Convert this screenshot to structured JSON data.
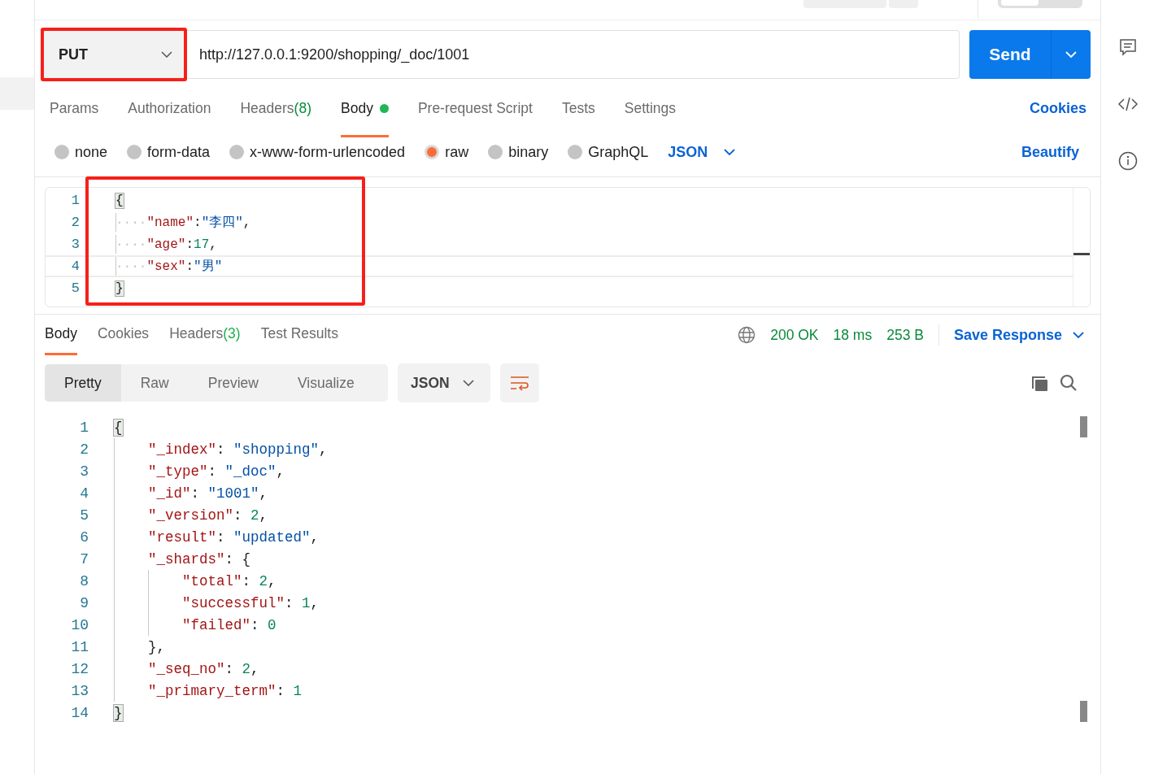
{
  "request": {
    "method": {
      "label": "PUT",
      "highlighted": true
    },
    "url": "http://127.0.0.1:9200/shopping/_doc/1001",
    "send": "Send"
  },
  "request_tabs": [
    {
      "label": "Params",
      "selected": false
    },
    {
      "label": "Authorization",
      "selected": false
    },
    {
      "label": "Headers",
      "count": "(8)",
      "selected": false
    },
    {
      "label": "Body",
      "selected": true,
      "dot": true
    },
    {
      "label": "Pre-request Script",
      "selected": false
    },
    {
      "label": "Tests",
      "selected": false
    },
    {
      "label": "Settings",
      "selected": false
    }
  ],
  "cookies_link": "Cookies",
  "body_types": [
    {
      "label": "none",
      "selected": false
    },
    {
      "label": "form-data",
      "selected": false
    },
    {
      "label": "x-www-form-urlencoded",
      "selected": false
    },
    {
      "label": "raw",
      "selected": true
    },
    {
      "label": "binary",
      "selected": false
    },
    {
      "label": "GraphQL",
      "selected": false
    }
  ],
  "language": "JSON",
  "beautify": "Beautify",
  "request_body": {
    "highlighted": true,
    "lines": [
      {
        "number": "1",
        "active": false,
        "tokens": [
          {
            "kind": "brace",
            "text": "{"
          }
        ]
      },
      {
        "number": "2",
        "active": false,
        "tokens": [
          {
            "kind": "ws",
            "text": "····"
          },
          {
            "kind": "key",
            "text": "\"name\""
          },
          {
            "kind": "punct",
            "text": ":"
          },
          {
            "kind": "string",
            "text": "\"李四\""
          },
          {
            "kind": "punct",
            "text": ","
          }
        ]
      },
      {
        "number": "3",
        "active": false,
        "tokens": [
          {
            "kind": "ws",
            "text": "····"
          },
          {
            "kind": "key",
            "text": "\"age\""
          },
          {
            "kind": "punct",
            "text": ":"
          },
          {
            "kind": "number",
            "text": "17"
          },
          {
            "kind": "punct",
            "text": ","
          }
        ]
      },
      {
        "number": "4",
        "active": true,
        "tokens": [
          {
            "kind": "ws",
            "text": "····"
          },
          {
            "kind": "key",
            "text": "\"sex\""
          },
          {
            "kind": "punct",
            "text": ":"
          },
          {
            "kind": "string",
            "text": "\"男\""
          }
        ]
      },
      {
        "number": "5",
        "active": false,
        "tokens": [
          {
            "kind": "brace",
            "text": "}"
          }
        ]
      }
    ]
  },
  "response": {
    "tabs": [
      {
        "label": "Body",
        "selected": true
      },
      {
        "label": "Cookies",
        "selected": false
      },
      {
        "label": "Headers",
        "count": "(3)",
        "selected": false
      },
      {
        "label": "Test Results",
        "selected": false
      }
    ],
    "status": "200 OK",
    "time": "18 ms",
    "size": "253 B",
    "save": "Save Response",
    "views": [
      {
        "label": "Pretty",
        "selected": true
      },
      {
        "label": "Raw",
        "selected": false
      },
      {
        "label": "Preview",
        "selected": false
      },
      {
        "label": "Visualize",
        "selected": false
      }
    ],
    "format": "JSON",
    "lines": [
      {
        "number": "1",
        "tokens": [
          {
            "kind": "brace",
            "text": "{"
          }
        ]
      },
      {
        "number": "2",
        "tokens": [
          {
            "kind": "key",
            "text": "    \"_index\""
          },
          {
            "kind": "punct",
            "text": ": "
          },
          {
            "kind": "string",
            "text": "\"shopping\""
          },
          {
            "kind": "punct",
            "text": ","
          }
        ]
      },
      {
        "number": "3",
        "tokens": [
          {
            "kind": "key",
            "text": "    \"_type\""
          },
          {
            "kind": "punct",
            "text": ": "
          },
          {
            "kind": "string",
            "text": "\"_doc\""
          },
          {
            "kind": "punct",
            "text": ","
          }
        ]
      },
      {
        "number": "4",
        "tokens": [
          {
            "kind": "key",
            "text": "    \"_id\""
          },
          {
            "kind": "punct",
            "text": ": "
          },
          {
            "kind": "string",
            "text": "\"1001\""
          },
          {
            "kind": "punct",
            "text": ","
          }
        ]
      },
      {
        "number": "5",
        "tokens": [
          {
            "kind": "key",
            "text": "    \"_version\""
          },
          {
            "kind": "punct",
            "text": ": "
          },
          {
            "kind": "number",
            "text": "2"
          },
          {
            "kind": "punct",
            "text": ","
          }
        ]
      },
      {
        "number": "6",
        "tokens": [
          {
            "kind": "key",
            "text": "    \"result\""
          },
          {
            "kind": "punct",
            "text": ": "
          },
          {
            "kind": "string",
            "text": "\"updated\""
          },
          {
            "kind": "punct",
            "text": ","
          }
        ]
      },
      {
        "number": "7",
        "tokens": [
          {
            "kind": "key",
            "text": "    \"_shards\""
          },
          {
            "kind": "punct",
            "text": ": {"
          }
        ]
      },
      {
        "number": "8",
        "tokens": [
          {
            "kind": "key",
            "text": "        \"total\""
          },
          {
            "kind": "punct",
            "text": ": "
          },
          {
            "kind": "number",
            "text": "2"
          },
          {
            "kind": "punct",
            "text": ","
          }
        ]
      },
      {
        "number": "9",
        "tokens": [
          {
            "kind": "key",
            "text": "        \"successful\""
          },
          {
            "kind": "punct",
            "text": ": "
          },
          {
            "kind": "number",
            "text": "1"
          },
          {
            "kind": "punct",
            "text": ","
          }
        ]
      },
      {
        "number": "10",
        "tokens": [
          {
            "kind": "key",
            "text": "        \"failed\""
          },
          {
            "kind": "punct",
            "text": ": "
          },
          {
            "kind": "number",
            "text": "0"
          }
        ]
      },
      {
        "number": "11",
        "tokens": [
          {
            "kind": "punct",
            "text": "    },"
          }
        ]
      },
      {
        "number": "12",
        "tokens": [
          {
            "kind": "key",
            "text": "    \"_seq_no\""
          },
          {
            "kind": "punct",
            "text": ": "
          },
          {
            "kind": "number",
            "text": "2"
          },
          {
            "kind": "punct",
            "text": ","
          }
        ]
      },
      {
        "number": "13",
        "tokens": [
          {
            "kind": "key",
            "text": "    \"_primary_term\""
          },
          {
            "kind": "punct",
            "text": ": "
          },
          {
            "kind": "number",
            "text": "1"
          }
        ]
      },
      {
        "number": "14",
        "tokens": [
          {
            "kind": "brace",
            "text": "}"
          }
        ]
      }
    ]
  }
}
